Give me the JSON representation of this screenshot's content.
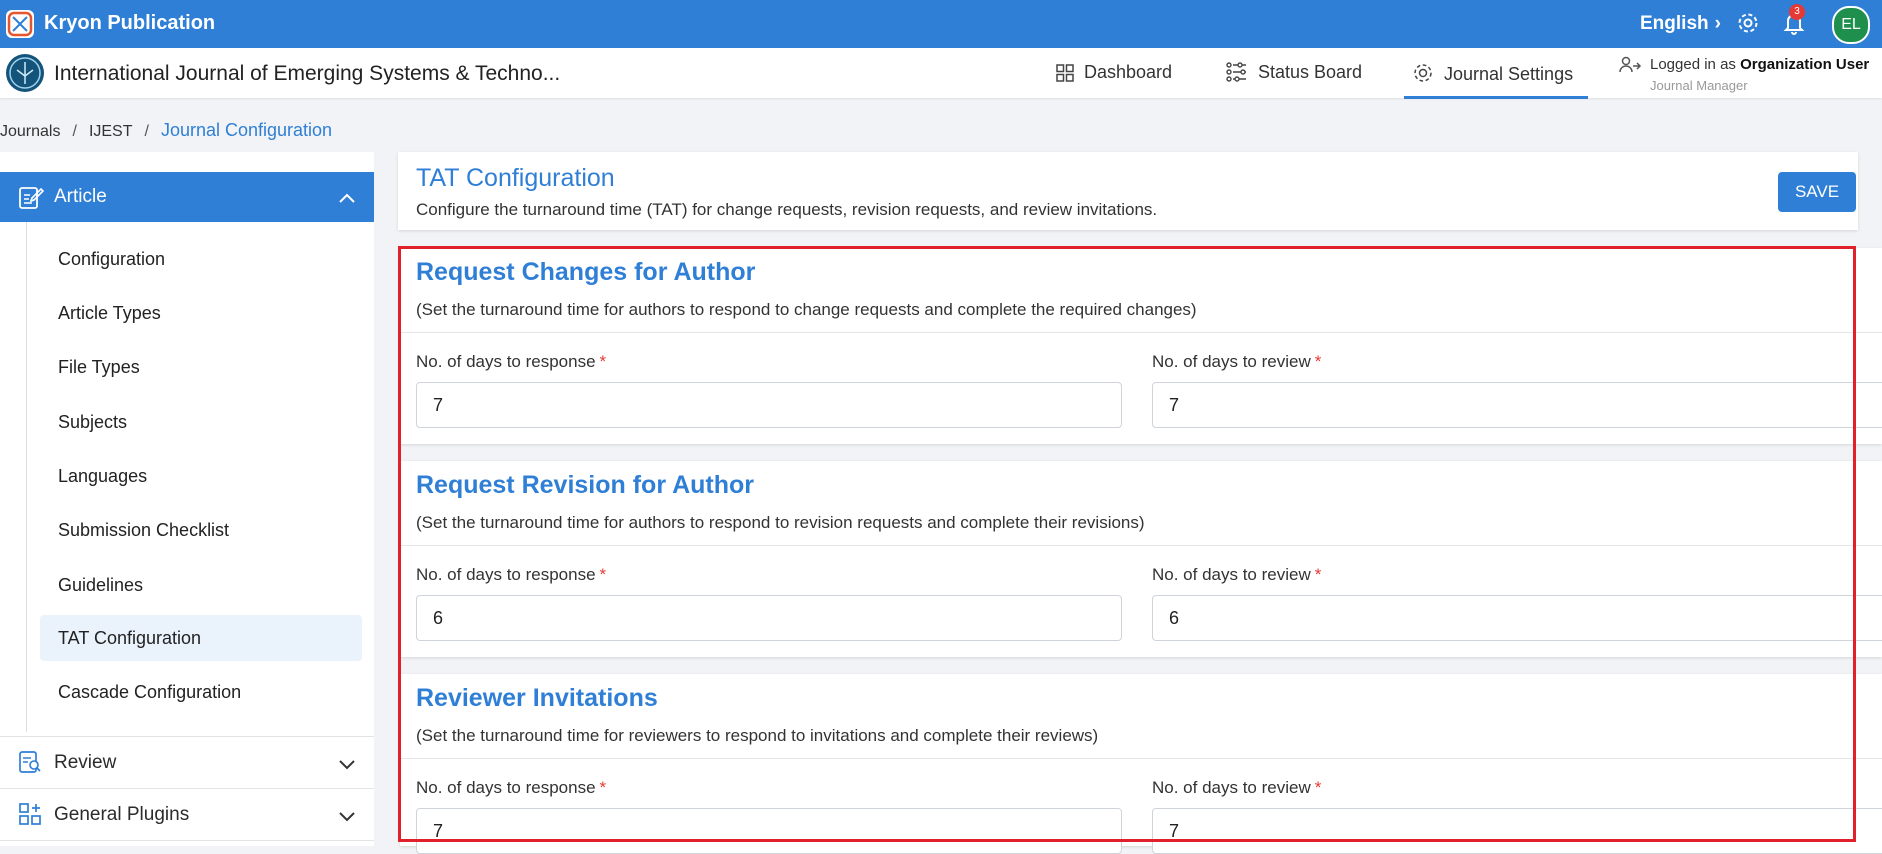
{
  "topbar": {
    "app_title": "Kryon Publication",
    "language": "English",
    "notification_count": "3",
    "avatar_initials": "EL"
  },
  "journal_header": {
    "title": "International Journal of Emerging Systems & Techno...",
    "nav": [
      {
        "label": "Dashboard",
        "icon": "grid-icon"
      },
      {
        "label": "Status Board",
        "icon": "status-board-icon"
      },
      {
        "label": "Journal Settings",
        "icon": "gear-icon",
        "active": true
      }
    ],
    "login_prefix": "Logged in as",
    "login_user": "Organization User",
    "login_role": "Journal Manager"
  },
  "breadcrumb": [
    "Journals",
    "IJEST",
    "Journal Configuration"
  ],
  "sidebar": {
    "article_label": "Article",
    "items": [
      "Configuration",
      "Article Types",
      "File Types",
      "Subjects",
      "Languages",
      "Submission Checklist",
      "Guidelines",
      "TAT Configuration",
      "Cascade Configuration"
    ],
    "active_item": "TAT Configuration",
    "review_label": "Review",
    "plugins_label": "General Plugins"
  },
  "main": {
    "title": "TAT Configuration",
    "description": "Configure the turnaround time (TAT) for change requests, revision requests, and review invitations.",
    "save_label": "SAVE",
    "sections": [
      {
        "title": "Request Changes for Author",
        "description": "(Set the turnaround time for authors to respond to change requests and complete the required changes)",
        "response_label": "No. of days to response",
        "response_value": "7",
        "review_label": "No. of days to review",
        "review_value": "7"
      },
      {
        "title": "Request Revision for Author",
        "description": "(Set the turnaround time for authors to respond to revision requests and complete their revisions)",
        "response_label": "No. of days to response",
        "response_value": "6",
        "review_label": "No. of days to review",
        "review_value": "6"
      },
      {
        "title": "Reviewer Invitations",
        "description": "(Set the turnaround time for reviewers to respond to invitations and complete their reviews)",
        "response_label": "No. of days to response",
        "response_value": "7",
        "review_label": "No. of days to review",
        "review_value": "7"
      }
    ],
    "required_marker": "*"
  },
  "colors": {
    "primary": "#2f7fd6",
    "highlight_border": "#e0202a",
    "required": "#e53935",
    "avatar": "#1f8f4e"
  }
}
